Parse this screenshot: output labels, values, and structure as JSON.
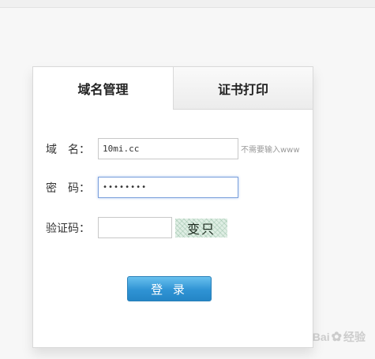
{
  "tabs": [
    {
      "label": "域名管理",
      "active": true
    },
    {
      "label": "证书打印",
      "active": false
    }
  ],
  "form": {
    "domain": {
      "label": "域　名：",
      "value": "10mi.cc",
      "hint": "不需要输入www"
    },
    "password": {
      "label": "密　码：",
      "value": "••••••••"
    },
    "captcha": {
      "label": "验证码：",
      "value": "",
      "image_text": "变只"
    }
  },
  "login_button": "登 录",
  "watermark": {
    "brand": "Bai",
    "suffix": "经验"
  },
  "colors": {
    "button": "#2f93d4",
    "focus_border": "#7ba0dc",
    "hint": "#999999"
  }
}
